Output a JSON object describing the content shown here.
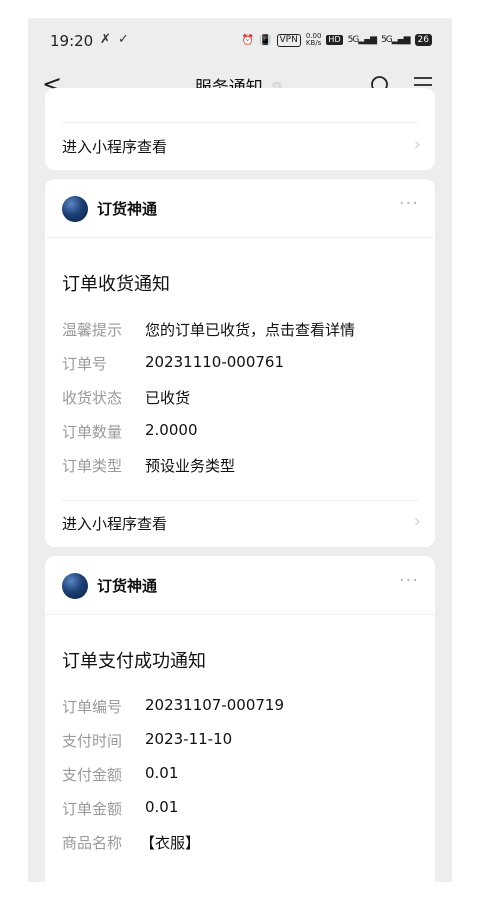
{
  "status_bar": {
    "time": "19:20",
    "glyphs": [
      "✗",
      "✓"
    ],
    "vpn": "VPN",
    "speed_top": "0.00",
    "speed_bottom": "KB/s",
    "hd": "HD",
    "signal1": "5G",
    "signal2": "5G",
    "battery": "26"
  },
  "nav": {
    "title": "服务通知",
    "back_icon": "back-chevron-icon",
    "search_icon": "search-icon",
    "menu_icon": "menu-icon"
  },
  "cards": [
    {
      "footer_label": "进入小程序查看"
    },
    {
      "sender": "订货神通",
      "title": "订单收货通知",
      "rows": [
        {
          "label": "温馨提示",
          "value": "您的订单已收货，点击查看详情"
        },
        {
          "label": "订单号",
          "value": "20231110-000761"
        },
        {
          "label": "收货状态",
          "value": "已收货"
        },
        {
          "label": "订单数量",
          "value": "2.0000"
        },
        {
          "label": "订单类型",
          "value": "预设业务类型"
        }
      ],
      "footer_label": "进入小程序查看"
    },
    {
      "sender": "订货神通",
      "title": "订单支付成功通知",
      "rows": [
        {
          "label": "订单编号",
          "value": "20231107-000719"
        },
        {
          "label": "支付时间",
          "value": "2023-11-10"
        },
        {
          "label": "支付金额",
          "value": "0.01"
        },
        {
          "label": "订单金额",
          "value": "0.01"
        },
        {
          "label": "商品名称",
          "value": "【衣服】"
        }
      ]
    }
  ]
}
